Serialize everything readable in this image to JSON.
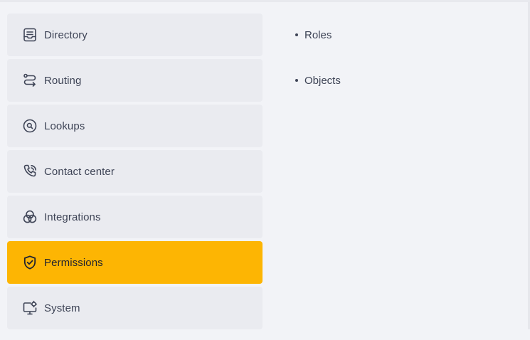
{
  "nav": {
    "items": [
      {
        "label": "Directory",
        "icon": "directory-icon",
        "active": false
      },
      {
        "label": "Routing",
        "icon": "routing-icon",
        "active": false
      },
      {
        "label": "Lookups",
        "icon": "lookups-icon",
        "active": false
      },
      {
        "label": "Contact center",
        "icon": "phone-icon",
        "active": false
      },
      {
        "label": "Integrations",
        "icon": "integrations-icon",
        "active": false
      },
      {
        "label": "Permissions",
        "icon": "shield-check-icon",
        "active": true
      },
      {
        "label": "System",
        "icon": "monitor-gear-icon",
        "active": false
      }
    ]
  },
  "submenu": {
    "items": [
      {
        "label": "Roles"
      },
      {
        "label": "Objects"
      }
    ]
  },
  "colors": {
    "background": "#f2f3f7",
    "item_bg": "#eaebf0",
    "active_bg": "#fdb503",
    "text": "#3e4456"
  }
}
